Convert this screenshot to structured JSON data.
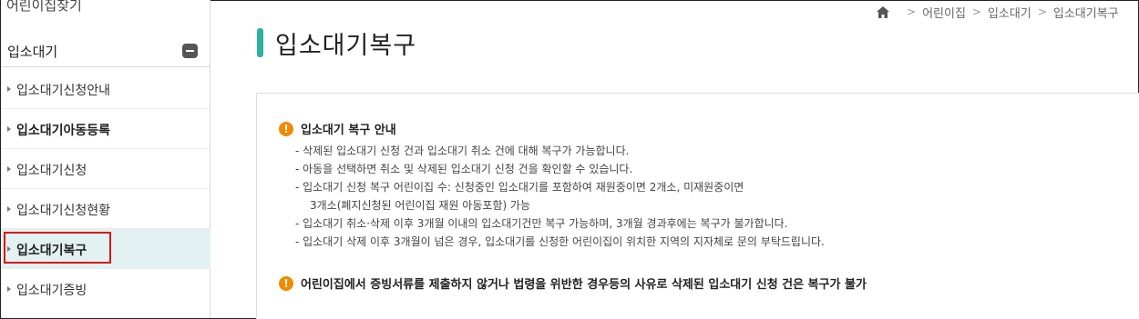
{
  "sidebar": {
    "top_label": "어린이집찾기",
    "section_title": "입소대기",
    "items": [
      {
        "label": "입소대기신청안내"
      },
      {
        "label": "입소대기아동등록"
      },
      {
        "label": "입소대기신청"
      },
      {
        "label": "입소대기신청현황"
      },
      {
        "label": "입소대기복구"
      },
      {
        "label": "입소대기증빙"
      }
    ]
  },
  "breadcrumb": {
    "home_icon": "home-icon",
    "crumbs": [
      "어린이집",
      "입소대기",
      "입소대기복구"
    ]
  },
  "page": {
    "title": "입소대기복구",
    "accent_color": "#2bb0a2"
  },
  "notice": {
    "icon": "warning-icon",
    "icon_color": "#f08a00",
    "title": "입소대기 복구 안내",
    "lines": [
      "- 삭제된 입소대기 신청 건과 입소대기 취소 건에 대해 복구가 가능합니다.",
      "- 아동을 선택하면 취소 및 삭제된 입소대기 신청 건을 확인할 수 있습니다.",
      "- 입소대기 신청 복구 어린이집 수: 신청중인 입소대기를 포함하여 재원중이면 2개소, 미재원중이면",
      "3개소(폐지신청된 어린이집 재원 아동포함) 가능",
      "- 입소대기 취소·삭제 이후 3개월 이내의 입소대기건만 복구 가능하며, 3개월 경과후에는 복구가 불가합니다.",
      "- 입소대기 삭제 이후 3개월이 넘은 경우, 입소대기를 신청한 어린이집이 위치한 지역의 지자체로 문의 부탁드립니다."
    ],
    "footer": "어린이집에서 증빙서류를 제출하지 않거나 법령을 위반한 경우등의 사유로 삭제된 입소대기 신청 건은 복구가 불가"
  }
}
